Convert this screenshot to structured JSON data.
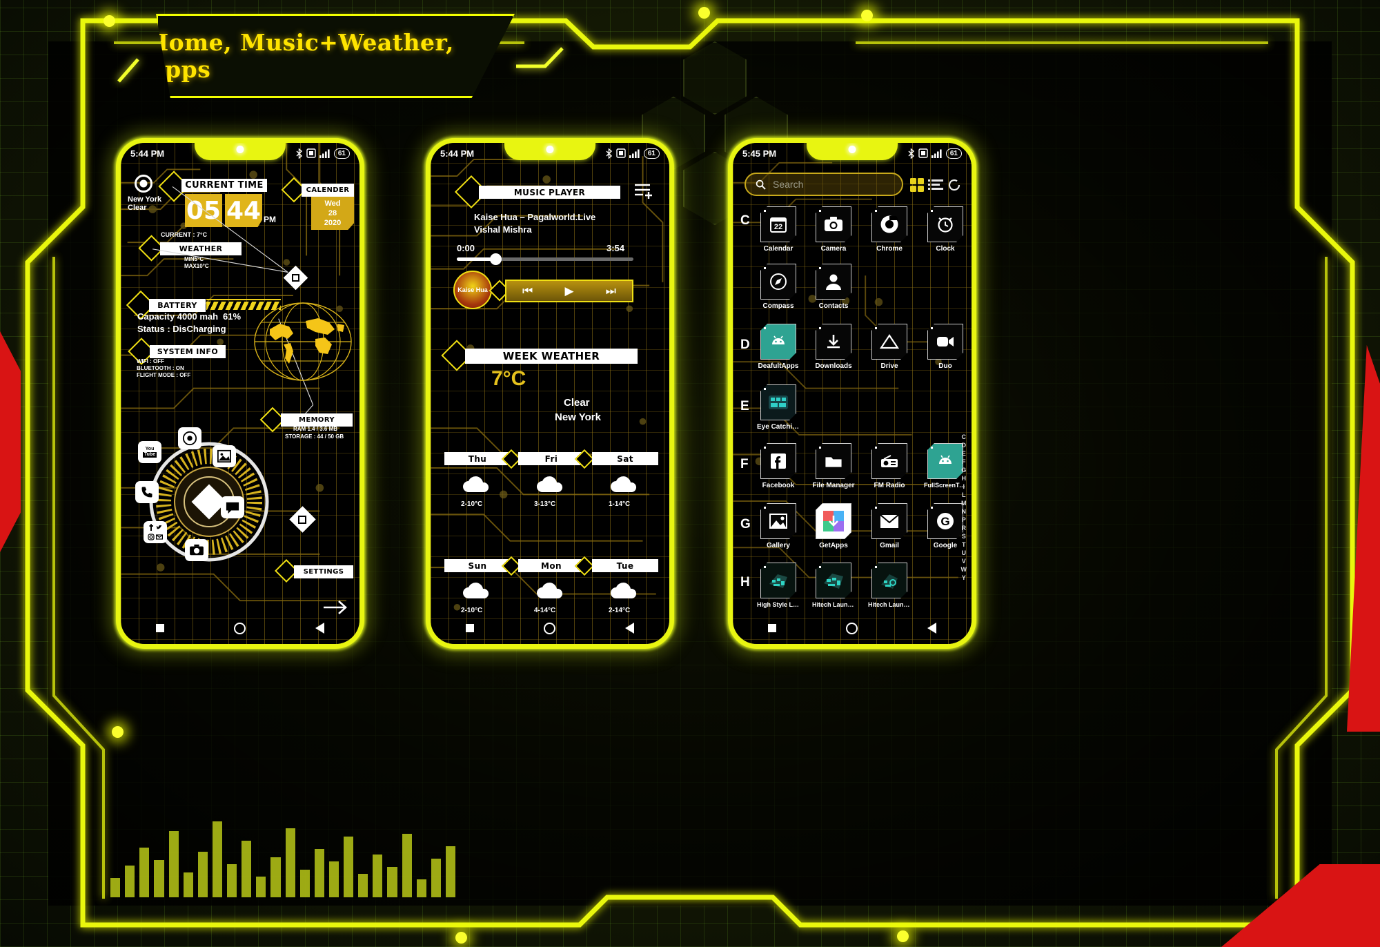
{
  "banner": {
    "title": "Home, Music+Weather, Apps"
  },
  "theme": {
    "neon_yellow": "#e8f511",
    "amber": "#e0b51a",
    "red_accent": "#d91414",
    "bg_green": "#2a3206"
  },
  "phone1": {
    "status": {
      "time": "5:44 PM",
      "bluetooth_icon": "bluetooth-icon",
      "sim_icon": "sim-icon",
      "signal_icon": "signal-icon",
      "battery": "61"
    },
    "location": {
      "icon": "location-target-icon",
      "city": "New York",
      "condition": "Clear"
    },
    "current_time": {
      "label": "CURRENT TIME",
      "hours": "05",
      "minutes": "44",
      "meridiem": "PM"
    },
    "calendar": {
      "label": "CALENDER",
      "weekday": "Wed",
      "day": "28",
      "year": "2020"
    },
    "weather": {
      "label": "WEATHER",
      "current": "CURRENT : 7°C",
      "min": "MIN5°C",
      "max": "MAX10°C"
    },
    "battery": {
      "label": "BATTERY",
      "capacity": "Capacity 4000 mah",
      "percent": "61%",
      "status": "Status : DisCharging",
      "fill_pct": 61
    },
    "system_info": {
      "label": "SYSTEM INFO",
      "wifi": "WIFI : OFF",
      "bluetooth": "BLUETOOTH : ON",
      "flight": "FLIGHT MODE : OFF"
    },
    "memory": {
      "label": "MEMORY",
      "ram": "RAM 1.4 / 3.6 MB",
      "storage": "STORAGE : 44 / 50 GB"
    },
    "settings": {
      "label": "SETTINGS",
      "arrow_icon": "arrow-right-icon"
    },
    "dock": [
      {
        "name": "chrome-icon",
        "label": "Chrome"
      },
      {
        "name": "gallery-icon",
        "label": "Gallery"
      },
      {
        "name": "messages-icon",
        "label": "Messages"
      },
      {
        "name": "camera-icon",
        "label": "Camera"
      },
      {
        "name": "social-icons",
        "label": "Social"
      },
      {
        "name": "phone-icon",
        "label": "Phone"
      },
      {
        "name": "youtube-icon",
        "label": "YouTube"
      }
    ],
    "nav": {
      "recents": "square-icon",
      "home": "circle-icon",
      "back": "triangle-back-icon"
    }
  },
  "phone2": {
    "status": {
      "time": "5:44 PM",
      "battery": "61"
    },
    "player": {
      "label": "MUSIC PLAYER",
      "playlist_icon": "playlist-add-icon",
      "track_title": "Kaise Hua – Pagalworld.Live",
      "artist": "Vishal Mishra",
      "elapsed": "0:00",
      "duration": "3:54",
      "progress_pct": 22,
      "album_art_text": "Kaise Hua",
      "controls": [
        {
          "name": "previous-button",
          "glyph": "⏮"
        },
        {
          "name": "play-button",
          "glyph": "▶"
        },
        {
          "name": "next-button",
          "glyph": "⏭"
        }
      ]
    },
    "week_weather": {
      "label": "WEEK WEATHER",
      "temperature": "7°C",
      "condition": "Clear",
      "city": "New York",
      "days": [
        {
          "day": "Thu",
          "icon": "cloud-icon",
          "range": "2-10°C"
        },
        {
          "day": "Fri",
          "icon": "cloud-icon",
          "range": "3-13°C"
        },
        {
          "day": "Sat",
          "icon": "cloud-icon",
          "range": "1-14°C"
        },
        {
          "day": "Sun",
          "icon": "cloud-icon",
          "range": "2-10°C"
        },
        {
          "day": "Mon",
          "icon": "cloud-icon",
          "range": "4-14°C"
        },
        {
          "day": "Tue",
          "icon": "cloud-icon",
          "range": "2-14°C"
        }
      ]
    }
  },
  "phone3": {
    "status": {
      "time": "5:45 PM",
      "battery": "61"
    },
    "search": {
      "placeholder": "Search",
      "icon": "search-icon"
    },
    "header_icons": [
      {
        "name": "grid-view-icon"
      },
      {
        "name": "list-view-icon"
      },
      {
        "name": "refresh-icon"
      }
    ],
    "sections": [
      {
        "letter": "C",
        "apps": [
          {
            "label": "Calendar",
            "icon": "calendar-icon"
          },
          {
            "label": "Camera",
            "icon": "camera-icon"
          },
          {
            "label": "Chrome",
            "icon": "chrome-icon"
          },
          {
            "label": "Clock",
            "icon": "alarm-clock-icon"
          },
          {
            "label": "Compass",
            "icon": "compass-icon"
          },
          {
            "label": "Contacts",
            "icon": "contacts-icon"
          }
        ]
      },
      {
        "letter": "D",
        "apps": [
          {
            "label": "DeafultApps",
            "icon": "android-icon"
          },
          {
            "label": "Downloads",
            "icon": "download-icon"
          },
          {
            "label": "Drive",
            "icon": "drive-icon"
          },
          {
            "label": "Duo",
            "icon": "duo-icon"
          }
        ]
      },
      {
        "letter": "E",
        "apps": [
          {
            "label": "Eye Catching ...",
            "icon": "eye-catching-icon"
          }
        ]
      },
      {
        "letter": "F",
        "apps": [
          {
            "label": "Facebook",
            "icon": "facebook-icon"
          },
          {
            "label": "File Manager",
            "icon": "folder-icon"
          },
          {
            "label": "FM Radio",
            "icon": "radio-icon"
          },
          {
            "label": "FullScreenTest",
            "icon": "android-icon"
          }
        ]
      },
      {
        "letter": "G",
        "apps": [
          {
            "label": "Gallery",
            "icon": "gallery-icon"
          },
          {
            "label": "GetApps",
            "icon": "getapps-icon"
          },
          {
            "label": "Gmail",
            "icon": "gmail-icon"
          },
          {
            "label": "Google",
            "icon": "google-icon"
          }
        ]
      },
      {
        "letter": "H",
        "apps": [
          {
            "label": "High Style La...",
            "icon": "launcher-icon"
          },
          {
            "label": "Hitech Launc...",
            "icon": "launcher-icon"
          },
          {
            "label": "Hitech Launc...",
            "icon": "launcher-icon"
          }
        ]
      }
    ],
    "alphabet_index": [
      "C",
      "D",
      "E",
      "F",
      "G",
      "H",
      "I",
      "L",
      "M",
      "N",
      "P",
      "R",
      "S",
      "T",
      "U",
      "V",
      "W",
      "Y"
    ]
  }
}
